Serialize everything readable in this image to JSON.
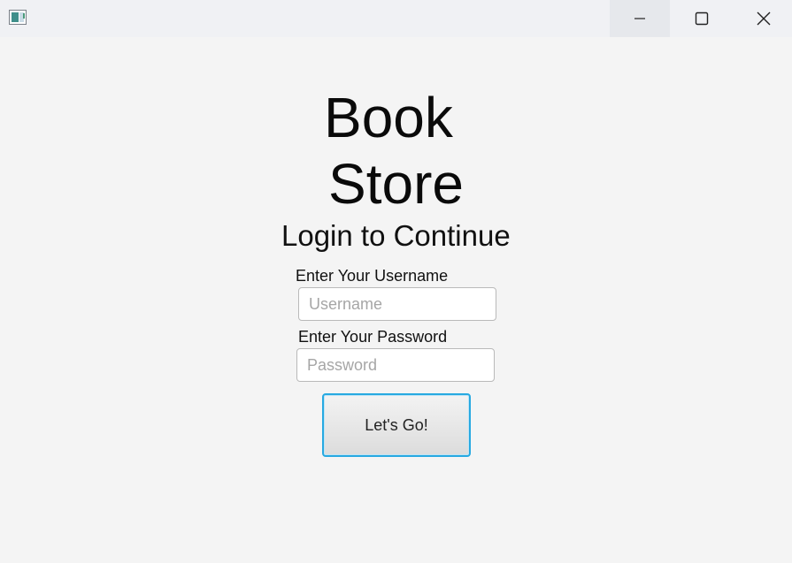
{
  "window": {
    "icon": "app-window-icon",
    "controls": [
      {
        "name": "minimize-icon"
      },
      {
        "name": "maximize-icon"
      },
      {
        "name": "close-icon"
      }
    ]
  },
  "header": {
    "title_line1": "Book",
    "title_line2": "Store",
    "subtitle": "Login to Continue"
  },
  "form": {
    "username_label": "Enter Your Username",
    "username_placeholder": "Username",
    "username_value": "",
    "password_label": "Enter Your Password",
    "password_placeholder": "Password",
    "password_value": "",
    "submit_label": "Let's Go!"
  },
  "colors": {
    "background": "#f4f4f4",
    "titlebar": "#f0f1f4",
    "button_focus_border": "#27a9e1"
  }
}
